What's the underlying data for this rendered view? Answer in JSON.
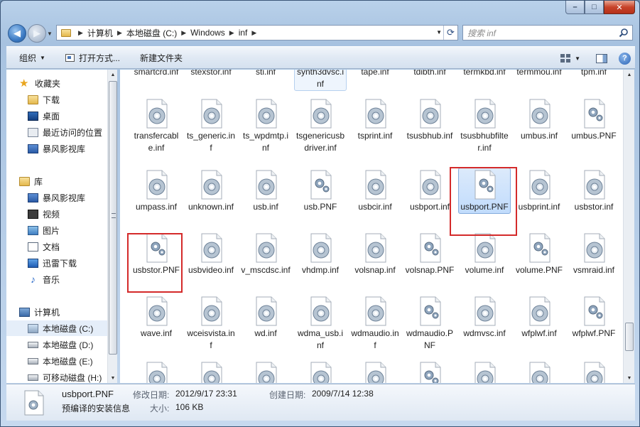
{
  "window": {
    "controls": {
      "minimize": "–",
      "maximize": "□",
      "close": "✕"
    }
  },
  "address": {
    "crumbs": [
      "计算机",
      "本地磁盘 (C:)",
      "Windows",
      "inf"
    ],
    "search_placeholder": "搜索 inf"
  },
  "toolbar": {
    "organize": "组织",
    "open_with": "打开方式...",
    "new_folder": "新建文件夹"
  },
  "sidebar": {
    "favorites": {
      "label": "收藏夹",
      "items": [
        "下载",
        "桌面",
        "最近访问的位置",
        "暴风影视库"
      ]
    },
    "libraries": {
      "label": "库",
      "items": [
        "暴风影视库",
        "视频",
        "图片",
        "文档",
        "迅雷下载",
        "音乐"
      ]
    },
    "computer": {
      "label": "计算机",
      "items": [
        "本地磁盘 (C:)",
        "本地磁盘 (D:)",
        "本地磁盘 (E:)",
        "可移动磁盘 (H:)"
      ],
      "selected": "本地磁盘 (C:)"
    }
  },
  "files": {
    "row0": [
      "smartcrd.inf",
      "stexstor.inf",
      "sti.inf",
      "synth3dvsc.inf",
      "tape.inf",
      "tdibth.inf",
      "termkbd.inf",
      "termmou.inf",
      "tpm.inf"
    ],
    "row1": [
      "transfercable.inf",
      "ts_generic.inf",
      "ts_wpdmtp.inf",
      "tsgenericusbdriver.inf",
      "tsprint.inf",
      "tsusbhub.inf",
      "tsusbhubfilter.inf",
      "umbus.inf",
      "umbus.PNF"
    ],
    "row2": [
      "umpass.inf",
      "unknown.inf",
      "usb.inf",
      "usb.PNF",
      "usbcir.inf",
      "usbport.inf",
      "usbport.PNF",
      "usbprint.inf",
      "usbstor.inf"
    ],
    "row3": [
      "usbstor.PNF",
      "usbvideo.inf",
      "v_mscdsc.inf",
      "vhdmp.inf",
      "volsnap.inf",
      "volsnap.PNF",
      "volume.inf",
      "volume.PNF",
      "vsmraid.inf"
    ],
    "row4": [
      "wave.inf",
      "wceisvista.inf",
      "wd.inf",
      "wdma_usb.inf",
      "wdmaudio.inf",
      "wdmaudio.PNF",
      "wdmvsc.inf",
      "wfplwf.inf",
      "wfplwf.PNF"
    ],
    "selected": "usbport.PNF",
    "icons": {
      "inf": "gear-document-icon",
      "PNF": "gear-document-icon"
    }
  },
  "details": {
    "name": "usbport.PNF",
    "type": "预编译的安装信息",
    "modified_label": "修改日期:",
    "modified": "2012/9/17 23:31",
    "created_label": "创建日期:",
    "created": "2009/7/14 12:38",
    "size_label": "大小:",
    "size": "106 KB"
  },
  "colors": {
    "highlight_box": "#d42a2a",
    "selection": "#c1dcfc"
  }
}
